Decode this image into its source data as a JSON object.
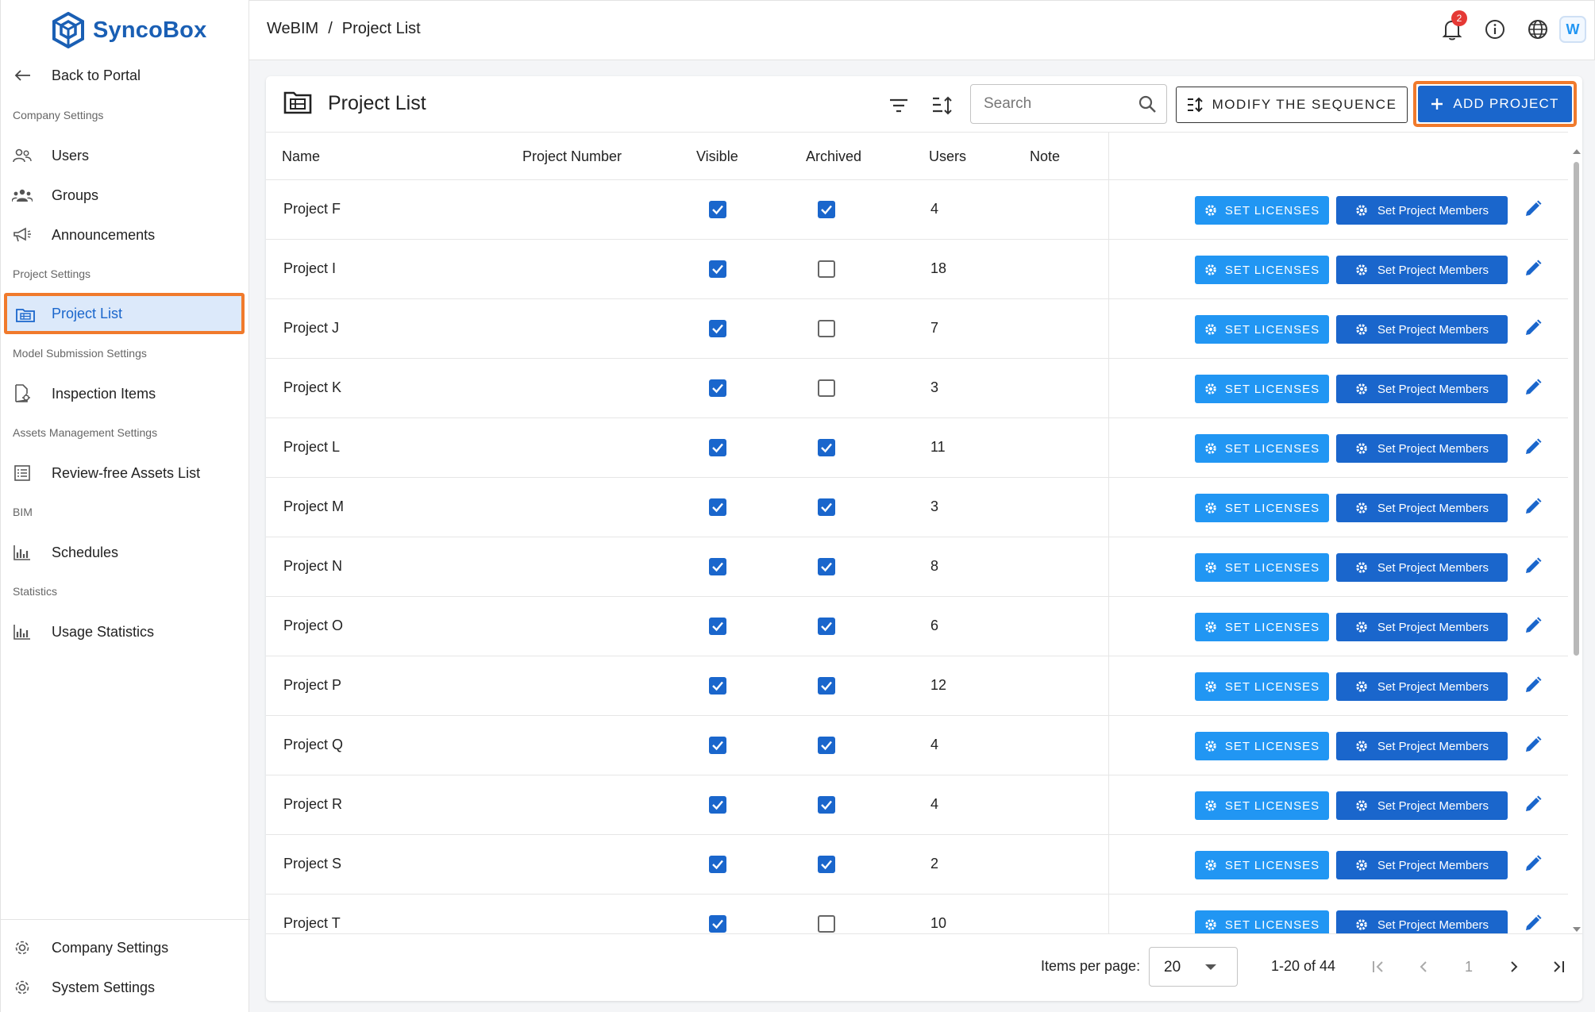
{
  "brand": {
    "name": "SyncoBox"
  },
  "sidebar": {
    "back_label": "Back to Portal",
    "sections": {
      "company": "Company Settings",
      "project": "Project Settings",
      "model": "Model Submission Settings",
      "assets": "Assets Management Settings",
      "bim": "BIM",
      "statistics": "Statistics"
    },
    "items": {
      "users": "Users",
      "groups": "Groups",
      "announcements": "Announcements",
      "project_list": "Project List",
      "inspection_items": "Inspection Items",
      "review_free": "Review-free Assets List",
      "schedules": "Schedules",
      "usage_statistics": "Usage Statistics"
    },
    "footer": {
      "company_settings": "Company Settings",
      "system_settings": "System Settings"
    }
  },
  "topbar": {
    "breadcrumb": [
      "WeBIM",
      "/",
      "Project List"
    ],
    "notification_count": "2",
    "app_badge": "W"
  },
  "card": {
    "title": "Project List",
    "search_placeholder": "Search",
    "modify_sequence_label": "MODIFY THE SEQUENCE",
    "add_project_label": "ADD PROJECT"
  },
  "table": {
    "columns": [
      "Name",
      "Project Number",
      "Visible",
      "Archived",
      "Users",
      "Note"
    ],
    "set_licenses_label": "SET LICENSES",
    "set_members_label": "Set Project Members",
    "rows": [
      {
        "name": "Project F",
        "visible": true,
        "archived": true,
        "users": "4"
      },
      {
        "name": "Project I",
        "visible": true,
        "archived": false,
        "users": "18"
      },
      {
        "name": "Project J",
        "visible": true,
        "archived": false,
        "users": "7"
      },
      {
        "name": "Project K",
        "visible": true,
        "archived": false,
        "users": "3"
      },
      {
        "name": "Project L",
        "visible": true,
        "archived": true,
        "users": "11"
      },
      {
        "name": "Project M",
        "visible": true,
        "archived": true,
        "users": "3"
      },
      {
        "name": "Project N",
        "visible": true,
        "archived": true,
        "users": "8"
      },
      {
        "name": "Project O",
        "visible": true,
        "archived": true,
        "users": "6"
      },
      {
        "name": "Project P",
        "visible": true,
        "archived": true,
        "users": "12"
      },
      {
        "name": "Project Q",
        "visible": true,
        "archived": true,
        "users": "4"
      },
      {
        "name": "Project R",
        "visible": true,
        "archived": true,
        "users": "4"
      },
      {
        "name": "Project S",
        "visible": true,
        "archived": true,
        "users": "2"
      },
      {
        "name": "Project T",
        "visible": true,
        "archived": false,
        "users": "10"
      }
    ]
  },
  "pagination": {
    "items_per_page_label": "Items per page:",
    "items_per_page": "20",
    "range": "1-20 of 44",
    "current_page": "1"
  },
  "colors": {
    "primary": "#1a66cc",
    "secondary_button": "#2196f3",
    "highlight_outline": "#f07a2c",
    "active_nav_bg": "#dce9fa"
  }
}
